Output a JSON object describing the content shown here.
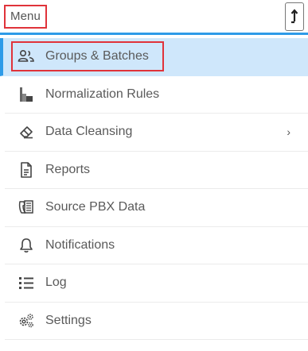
{
  "header": {
    "title": "Menu",
    "collapse_icon": "arrow-up-bar-icon"
  },
  "colors": {
    "accent": "#2e9be8",
    "active_bg": "#cfe7fb",
    "highlight_outline": "#e0333a",
    "text": "#5a5a5a"
  },
  "nav": {
    "items": [
      {
        "label": "Groups & Batches",
        "icon": "users-icon",
        "active": true
      },
      {
        "label": "Normalization Rules",
        "icon": "normalization-icon"
      },
      {
        "label": "Data Cleansing",
        "icon": "eraser-icon",
        "has_submenu": true,
        "chevron": "›"
      },
      {
        "label": "Reports",
        "icon": "document-icon"
      },
      {
        "label": "Source PBX Data",
        "icon": "pbx-phone-icon"
      },
      {
        "label": "Notifications",
        "icon": "bell-icon"
      },
      {
        "label": "Log",
        "icon": "list-icon"
      },
      {
        "label": "Settings",
        "icon": "gears-icon"
      }
    ]
  }
}
